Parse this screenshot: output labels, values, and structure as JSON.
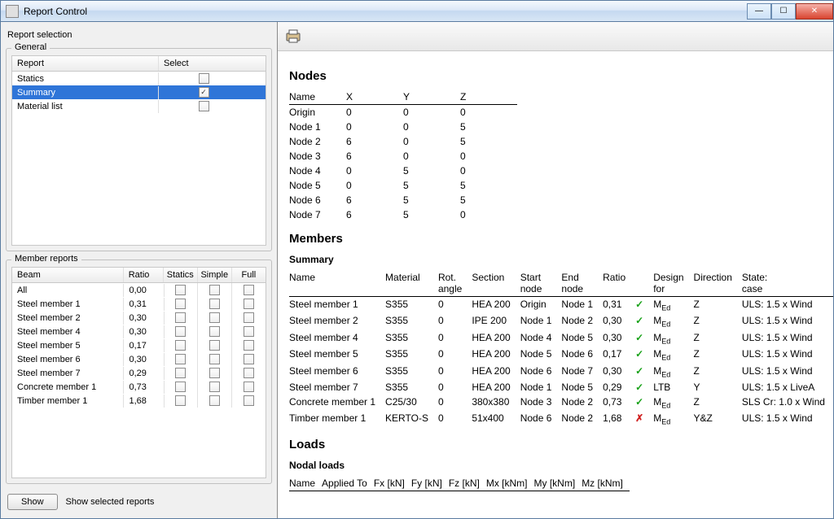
{
  "window": {
    "title": "Report Control"
  },
  "left": {
    "selection_label": "Report selection",
    "general": {
      "legend": "General",
      "col_report": "Report",
      "col_select": "Select",
      "rows": [
        {
          "name": "Statics",
          "checked": false,
          "selected": false
        },
        {
          "name": "Summary",
          "checked": true,
          "selected": true
        },
        {
          "name": "Material list",
          "checked": false,
          "selected": false
        }
      ]
    },
    "members": {
      "legend": "Member reports",
      "col_beam": "Beam",
      "col_ratio": "Ratio",
      "col_statics": "Statics",
      "col_simple": "Simple",
      "col_full": "Full",
      "rows": [
        {
          "beam": "All",
          "ratio": "0,00"
        },
        {
          "beam": "Steel member 1",
          "ratio": "0,31"
        },
        {
          "beam": "Steel member 2",
          "ratio": "0,30"
        },
        {
          "beam": "Steel member 4",
          "ratio": "0,30"
        },
        {
          "beam": "Steel member 5",
          "ratio": "0,17"
        },
        {
          "beam": "Steel member 6",
          "ratio": "0,30"
        },
        {
          "beam": "Steel member 7",
          "ratio": "0,29"
        },
        {
          "beam": "Concrete member 1",
          "ratio": "0,73"
        },
        {
          "beam": "Timber member 1",
          "ratio": "1,68"
        }
      ]
    },
    "show_button": "Show",
    "show_link": "Show selected reports"
  },
  "report": {
    "nodes_heading": "Nodes",
    "nodes_headers": [
      "Name",
      "X",
      "Y",
      "Z"
    ],
    "nodes": [
      [
        "Origin",
        "0",
        "0",
        "0"
      ],
      [
        "Node 1",
        "0",
        "0",
        "5"
      ],
      [
        "Node 2",
        "6",
        "0",
        "5"
      ],
      [
        "Node 3",
        "6",
        "0",
        "0"
      ],
      [
        "Node 4",
        "0",
        "5",
        "0"
      ],
      [
        "Node 5",
        "0",
        "5",
        "5"
      ],
      [
        "Node 6",
        "6",
        "5",
        "5"
      ],
      [
        "Node 7",
        "6",
        "5",
        "0"
      ]
    ],
    "members_heading": "Members",
    "summary_heading": "Summary",
    "members_headers": [
      "Name",
      "Material",
      "Rot. angle",
      "Section",
      "Start node",
      "End node",
      "Ratio",
      "",
      "Design for",
      "Direction",
      "State: case"
    ],
    "members": [
      {
        "name": "Steel member 1",
        "material": "S355",
        "rot": "0",
        "section": "HEA 200",
        "start": "Origin",
        "end": "Node 1",
        "ratio": "0,31",
        "status": "ok",
        "design": "M_Ed",
        "dir": "Z",
        "state": "ULS: 1.5 x Wind"
      },
      {
        "name": "Steel member 2",
        "material": "S355",
        "rot": "0",
        "section": "IPE 200",
        "start": "Node 1",
        "end": "Node 2",
        "ratio": "0,30",
        "status": "ok",
        "design": "M_Ed",
        "dir": "Z",
        "state": "ULS: 1.5 x Wind"
      },
      {
        "name": "Steel member 4",
        "material": "S355",
        "rot": "0",
        "section": "HEA 200",
        "start": "Node 4",
        "end": "Node 5",
        "ratio": "0,30",
        "status": "ok",
        "design": "M_Ed",
        "dir": "Z",
        "state": "ULS: 1.5 x Wind"
      },
      {
        "name": "Steel member 5",
        "material": "S355",
        "rot": "0",
        "section": "HEA 200",
        "start": "Node 5",
        "end": "Node 6",
        "ratio": "0,17",
        "status": "ok",
        "design": "M_Ed",
        "dir": "Z",
        "state": "ULS: 1.5 x Wind"
      },
      {
        "name": "Steel member 6",
        "material": "S355",
        "rot": "0",
        "section": "HEA 200",
        "start": "Node 6",
        "end": "Node 7",
        "ratio": "0,30",
        "status": "ok",
        "design": "M_Ed",
        "dir": "Z",
        "state": "ULS: 1.5 x Wind"
      },
      {
        "name": "Steel member 7",
        "material": "S355",
        "rot": "0",
        "section": "HEA 200",
        "start": "Node 1",
        "end": "Node 5",
        "ratio": "0,29",
        "status": "ok",
        "design": "LTB",
        "dir": "Y",
        "state": "ULS: 1.5 x LiveA"
      },
      {
        "name": "Concrete member 1",
        "material": "C25/30",
        "rot": "0",
        "section": "380x380",
        "start": "Node 3",
        "end": "Node 2",
        "ratio": "0,73",
        "status": "ok",
        "design": "M_Ed",
        "dir": "Z",
        "state": "SLS Cr: 1.0 x Wind"
      },
      {
        "name": "Timber member 1",
        "material": "KERTO-S",
        "rot": "0",
        "section": "51x400",
        "start": "Node 6",
        "end": "Node 2",
        "ratio": "1,68",
        "status": "fail",
        "design": "M_Ed",
        "dir": "Y&Z",
        "state": "ULS: 1.5 x Wind"
      }
    ],
    "loads_heading": "Loads",
    "nodal_loads_heading": "Nodal loads",
    "loads_headers": [
      "Name",
      "Applied To",
      "Fx [kN]",
      "Fy [kN]",
      "Fz [kN]",
      "Mx [kNm]",
      "My [kNm]",
      "Mz [kNm]"
    ]
  }
}
